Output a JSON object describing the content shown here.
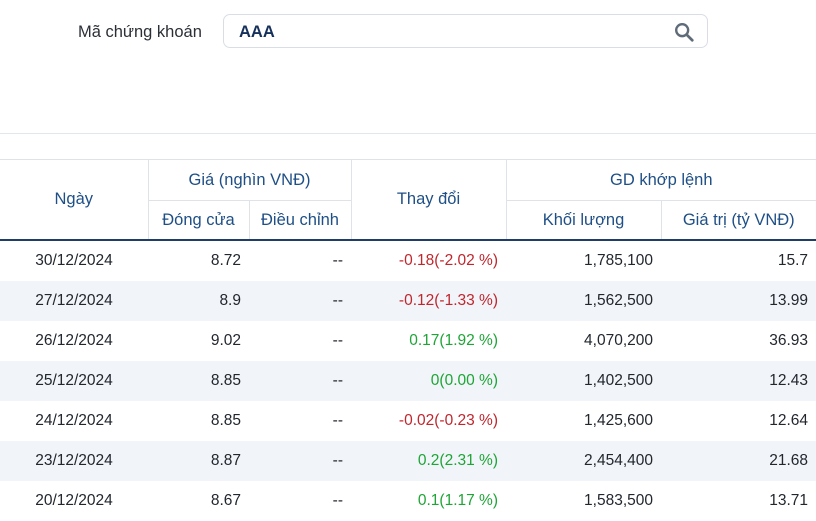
{
  "search": {
    "label": "Mã chứng khoán",
    "value": "AAA"
  },
  "table": {
    "headers": {
      "date": "Ngày",
      "price_group": "Giá (nghìn VNĐ)",
      "close": "Đóng cửa",
      "adjusted": "Điều chỉnh",
      "change": "Thay đổi",
      "matched_group": "GD khớp lệnh",
      "volume": "Khối lượng",
      "value": "Giá trị (tỷ VNĐ)"
    },
    "rows": [
      {
        "date": "30/12/2024",
        "close": "8.72",
        "adjusted": "--",
        "change": "-0.18(-2.02 %)",
        "direction": "down",
        "volume": "1,785,100",
        "value": "15.7"
      },
      {
        "date": "27/12/2024",
        "close": "8.9",
        "adjusted": "--",
        "change": "-0.12(-1.33 %)",
        "direction": "down",
        "volume": "1,562,500",
        "value": "13.99"
      },
      {
        "date": "26/12/2024",
        "close": "9.02",
        "adjusted": "--",
        "change": "0.17(1.92 %)",
        "direction": "up",
        "volume": "4,070,200",
        "value": "36.93"
      },
      {
        "date": "25/12/2024",
        "close": "8.85",
        "adjusted": "--",
        "change": "0(0.00 %)",
        "direction": "flat",
        "volume": "1,402,500",
        "value": "12.43"
      },
      {
        "date": "24/12/2024",
        "close": "8.85",
        "adjusted": "--",
        "change": "-0.02(-0.23 %)",
        "direction": "down",
        "volume": "1,425,600",
        "value": "12.64"
      },
      {
        "date": "23/12/2024",
        "close": "8.87",
        "adjusted": "--",
        "change": "0.2(2.31 %)",
        "direction": "up",
        "volume": "2,454,400",
        "value": "21.68"
      },
      {
        "date": "20/12/2024",
        "close": "8.67",
        "adjusted": "--",
        "change": "0.1(1.17 %)",
        "direction": "up",
        "volume": "1,583,500",
        "value": "13.71"
      }
    ]
  },
  "colors": {
    "down": "#c0262d",
    "up": "#1ea536",
    "header_text": "#1e4f86"
  }
}
